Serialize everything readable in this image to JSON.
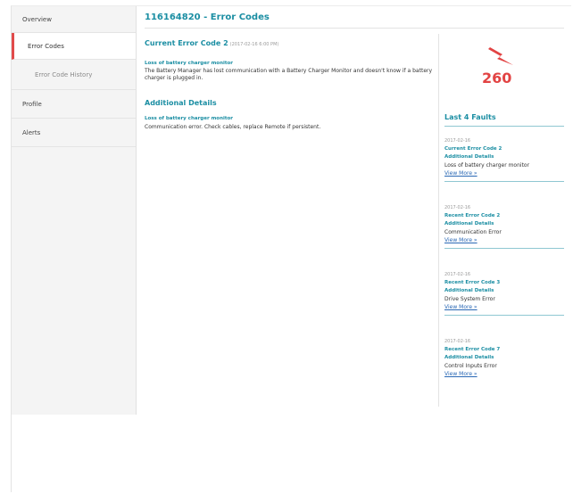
{
  "sidebar": {
    "items": [
      {
        "label": "Overview"
      },
      {
        "label": "Error Codes"
      },
      {
        "label": "Error Code History"
      },
      {
        "label": "Profile"
      },
      {
        "label": "Alerts"
      }
    ]
  },
  "main": {
    "title": "116164820 - Error Codes",
    "current": {
      "title": "Current Error Code 2",
      "date": "(2017-02-16 6:00 PM)",
      "label": "Loss of battery charger monitor",
      "description": "The Battery Manager has lost communication with a Battery Charger Monitor and doesn't know if a battery charger is plugged in."
    },
    "additional": {
      "title": "Additional Details",
      "label": "Loss of battery charger monitor",
      "description": "Communication error. Check cables, replace Remote if persistent."
    }
  },
  "right": {
    "counter": "260",
    "counter_color": "#e24343",
    "faults_title": "Last 4 Faults",
    "details_label": "Additional Details",
    "view_more": "View More »",
    "faults": [
      {
        "date": "2017-02-16",
        "code": "Current Error Code 2",
        "desc": "Loss of battery charger monitor"
      },
      {
        "date": "2017-02-16",
        "code": "Recent Error Code 2",
        "desc": "Communication Error"
      },
      {
        "date": "2017-02-16",
        "code": "Recent Error Code 3",
        "desc": "Drive System Error"
      },
      {
        "date": "2017-02-16",
        "code": "Recent Error Code 7",
        "desc": "Control Inputs Error"
      }
    ]
  }
}
